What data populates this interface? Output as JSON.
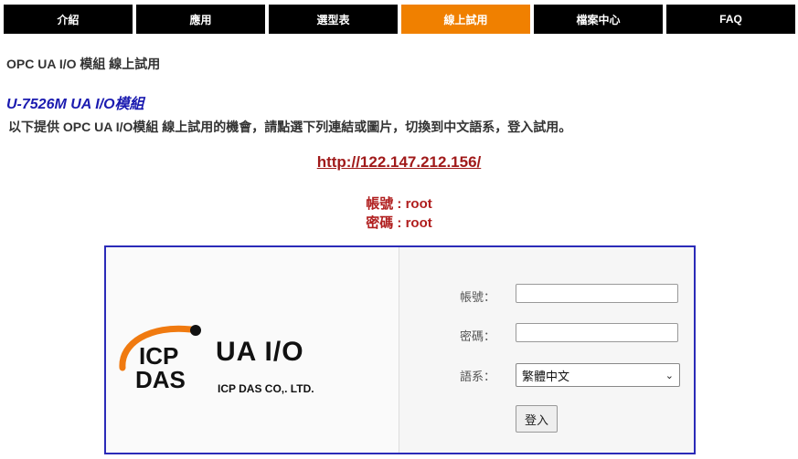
{
  "nav": {
    "tabs": [
      {
        "label": "介紹"
      },
      {
        "label": "應用"
      },
      {
        "label": "選型表"
      },
      {
        "label": "線上試用"
      },
      {
        "label": "檔案中心"
      },
      {
        "label": "FAQ"
      }
    ],
    "active_index": 3,
    "active_color": "#f08000"
  },
  "page": {
    "title": "OPC UA I/O 模組 線上試用",
    "model_title": "U-7526M UA I/O模組",
    "intro": "以下提供 OPC UA I/O模組 線上試用的機會，請點選下列連結或圖片，切換到中文語系，登入試用。",
    "demo_url": "http://122.147.212.156/",
    "account": "帳號 : root",
    "password": "密碼 : root"
  },
  "login_panel": {
    "logo_text": "ICP DAS",
    "brand_main": "UA I/O",
    "brand_sub": "ICP DAS CO,. LTD.",
    "user_label": "帳號：",
    "pass_label": "密碼：",
    "lang_label": "語系：",
    "lang_value": "繁體中文",
    "login_button": "登入"
  }
}
